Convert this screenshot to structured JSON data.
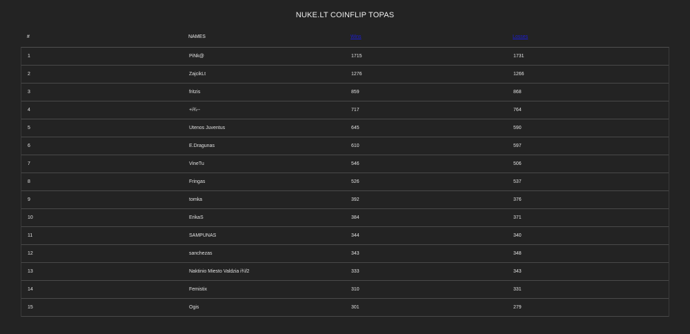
{
  "title": "NUKE.LT COINFLIP TOPAS",
  "header": {
    "rank": "#",
    "names": "NAMES",
    "col3": "Wins",
    "col4": "Losses"
  },
  "rows": [
    {
      "rank": "1",
      "name": "PiNk@",
      "a": "1715",
      "b": "1731"
    },
    {
      "rank": "2",
      "name": "ZajcikLt",
      "a": "1276",
      "b": "1266"
    },
    {
      "rank": "3",
      "name": "fritzis",
      "a": "859",
      "b": "868"
    },
    {
      "rank": "4",
      "name": "+i¾--",
      "a": "717",
      "b": "764"
    },
    {
      "rank": "5",
      "name": "Utenos Juventus",
      "a": "645",
      "b": "590"
    },
    {
      "rank": "6",
      "name": "E.Dragunas",
      "a": "610",
      "b": "597"
    },
    {
      "rank": "7",
      "name": "VineTu",
      "a": "546",
      "b": "506"
    },
    {
      "rank": "8",
      "name": "Fringas",
      "a": "526",
      "b": "537"
    },
    {
      "rank": "9",
      "name": "tomka",
      "a": "392",
      "b": "376"
    },
    {
      "rank": "10",
      "name": "ErikaS",
      "a": "384",
      "b": "371"
    },
    {
      "rank": "11",
      "name": "SAMPUNAS",
      "a": "344",
      "b": "340"
    },
    {
      "rank": "12",
      "name": "sanchezas",
      "a": "343",
      "b": "348"
    },
    {
      "rank": "13",
      "name": "Naktinio Miesto Valdzia i¾f2",
      "a": "333",
      "b": "343"
    },
    {
      "rank": "14",
      "name": "Femistix",
      "a": "310",
      "b": "331"
    },
    {
      "rank": "15",
      "name": "Ogis",
      "a": "301",
      "b": "279"
    }
  ]
}
